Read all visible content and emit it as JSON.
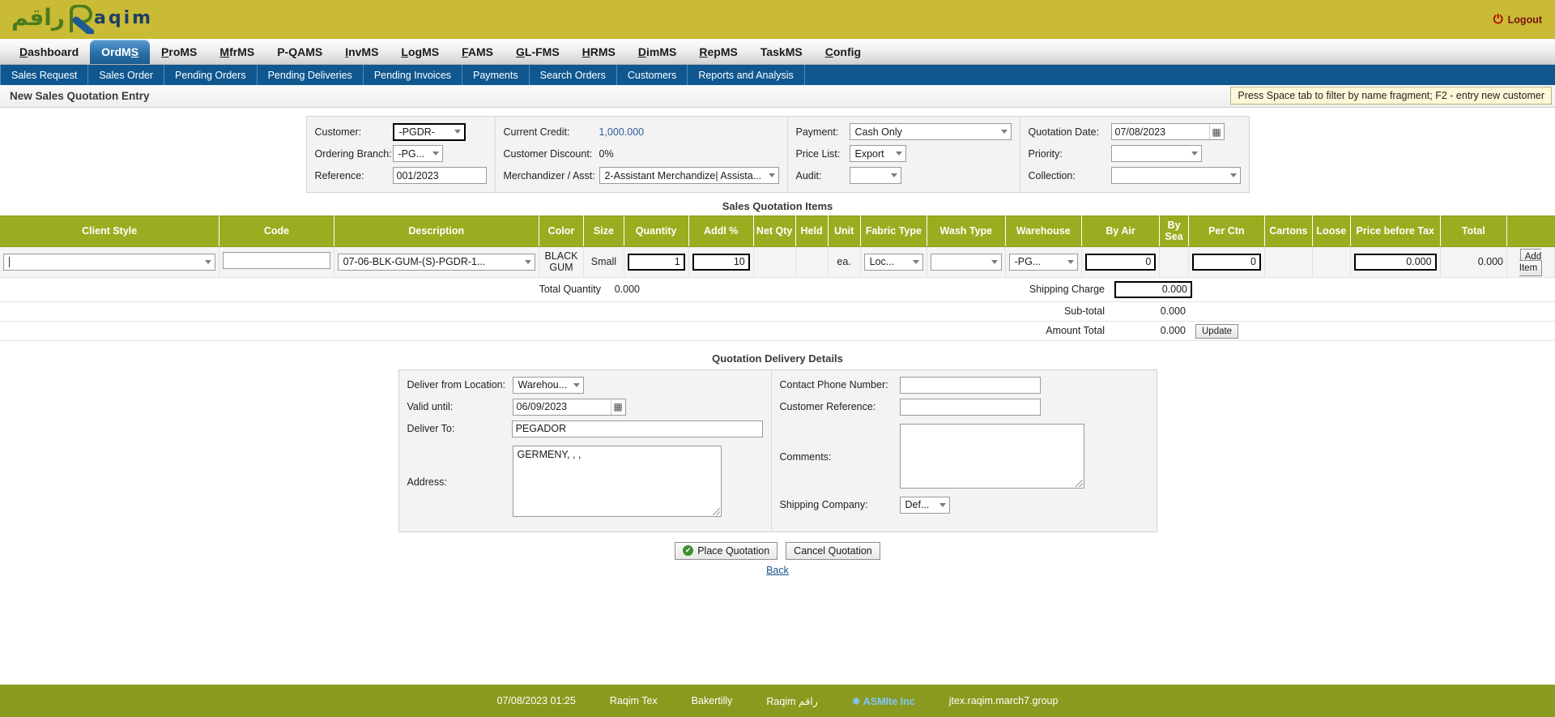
{
  "brand": {
    "arabic": "راقم",
    "word": "aqim",
    "logout_label": "Logout",
    "power_icon": "power-icon",
    "bar_color": "#c9bb35"
  },
  "main_tabs": [
    {
      "label": "Dashboard",
      "accel": "D",
      "active": false
    },
    {
      "label": "OrdMS",
      "accel": "S",
      "active": true
    },
    {
      "label": "ProMS",
      "accel": "P",
      "active": false
    },
    {
      "label": "MfrMS",
      "accel": "M",
      "active": false
    },
    {
      "label": "P-QAMS",
      "accel": "",
      "active": false
    },
    {
      "label": "InvMS",
      "accel": "I",
      "active": false
    },
    {
      "label": "LogMS",
      "accel": "L",
      "active": false
    },
    {
      "label": "FAMS",
      "accel": "F",
      "active": false
    },
    {
      "label": "GL-FMS",
      "accel": "G",
      "active": false
    },
    {
      "label": "HRMS",
      "accel": "H",
      "active": false
    },
    {
      "label": "DimMS",
      "accel": "D",
      "active": false
    },
    {
      "label": "RepMS",
      "accel": "R",
      "active": false
    },
    {
      "label": "TaskMS",
      "accel": "",
      "active": false
    },
    {
      "label": "Config",
      "accel": "C",
      "active": false
    }
  ],
  "subnav": [
    {
      "label": "Sales Request"
    },
    {
      "label": "Sales Order"
    },
    {
      "label": "Pending Orders"
    },
    {
      "label": "Pending Deliveries"
    },
    {
      "label": "Pending Invoices"
    },
    {
      "label": "Payments"
    },
    {
      "label": "Search Orders"
    },
    {
      "label": "Customers"
    },
    {
      "label": "Reports and Analysis"
    }
  ],
  "page": {
    "title": "New Sales Quotation Entry",
    "hint": "Press Space tab to filter by name fragment; F2 - entry new customer"
  },
  "header_form": {
    "customer_label": "Customer:",
    "customer_value": "-PGDR-",
    "ordering_branch_label": "Ordering Branch:",
    "ordering_branch_value": "-PG...",
    "reference_label": "Reference:",
    "reference_value": "001/2023",
    "current_credit_label": "Current Credit:",
    "current_credit_value": "1,000.000",
    "customer_discount_label": "Customer Discount:",
    "customer_discount_value": "0%",
    "merchandizer_label": "Merchandizer / Asst:",
    "merchandizer_value": "2-Assistant Merchandize| Assista...",
    "payment_label": "Payment:",
    "payment_value": "Cash Only",
    "price_list_label": "Price List:",
    "price_list_value": "Export",
    "audit_label": "Audit:",
    "audit_value": "",
    "quotation_date_label": "Quotation Date:",
    "quotation_date_value": "07/08/2023",
    "priority_label": "Priority:",
    "priority_value": "",
    "collection_label": "Collection:",
    "collection_value": "",
    "calendar_icon": "calendar-icon"
  },
  "items": {
    "section_title": "Sales Quotation Items",
    "columns": [
      "Client Style",
      "Code",
      "Description",
      "Color",
      "Size",
      "Quantity",
      "Addl %",
      "Net Qty",
      "Held",
      "Unit",
      "Fabric Type",
      "Wash Type",
      "Warehouse",
      "By Air",
      "By Sea",
      "Per Ctn",
      "Cartons",
      "Loose",
      "Price before Tax",
      "Total",
      ""
    ],
    "row": {
      "client_style": "",
      "code": "",
      "description": "07-06-BLK-GUM-(S)-PGDR-1...",
      "color": "BLACK GUM",
      "size": "Small",
      "quantity": "1",
      "addl_pct": "10",
      "net_qty": "",
      "held": "",
      "unit": "ea.",
      "fabric_type": "Loc...",
      "wash_type": "",
      "warehouse": "-PG...",
      "by_air": "0",
      "by_sea": "",
      "per_ctn": "0",
      "cartons": "",
      "loose": "",
      "price_before_tax": "0.000",
      "total": "0.000",
      "add_item_label": "Add Item"
    },
    "totals": {
      "total_quantity_label": "Total Quantity",
      "total_quantity_value": "0.000",
      "shipping_charge_label": "Shipping Charge",
      "shipping_charge_value": "0.000",
      "subtotal_label": "Sub-total",
      "subtotal_value": "0.000",
      "amount_total_label": "Amount Total",
      "amount_total_value": "0.000",
      "update_label": "Update"
    }
  },
  "delivery": {
    "section_title": "Quotation Delivery Details",
    "deliver_from_label": "Deliver from Location:",
    "deliver_from_value": "Warehou...",
    "valid_until_label": "Valid until:",
    "valid_until_value": "06/09/2023",
    "deliver_to_label": "Deliver To:",
    "deliver_to_value": "PEGADOR",
    "address_label": "Address:",
    "address_value": "GERMENY, , ,",
    "contact_phone_label": "Contact Phone Number:",
    "contact_phone_value": "",
    "customer_reference_label": "Customer Reference:",
    "customer_reference_value": "",
    "comments_label": "Comments:",
    "comments_value": "",
    "shipping_company_label": "Shipping Company:",
    "shipping_company_value": "Def...",
    "calendar_icon": "calendar-icon"
  },
  "actions": {
    "place_label": "Place Quotation",
    "cancel_label": "Cancel Quotation",
    "back_label": "Back",
    "check_icon": "check-circle-icon"
  },
  "footer": {
    "timestamp": "07/08/2023 01:25",
    "company": "Raqim Tex",
    "partner": "Bakertilly",
    "vendor": "Raqim",
    "vendor_ar": "راقم",
    "asmite": "ASMIte Inc",
    "asterisk": "✵",
    "host": "jtex.raqim.march7.group",
    "bg_color": "#8a9a1e"
  }
}
